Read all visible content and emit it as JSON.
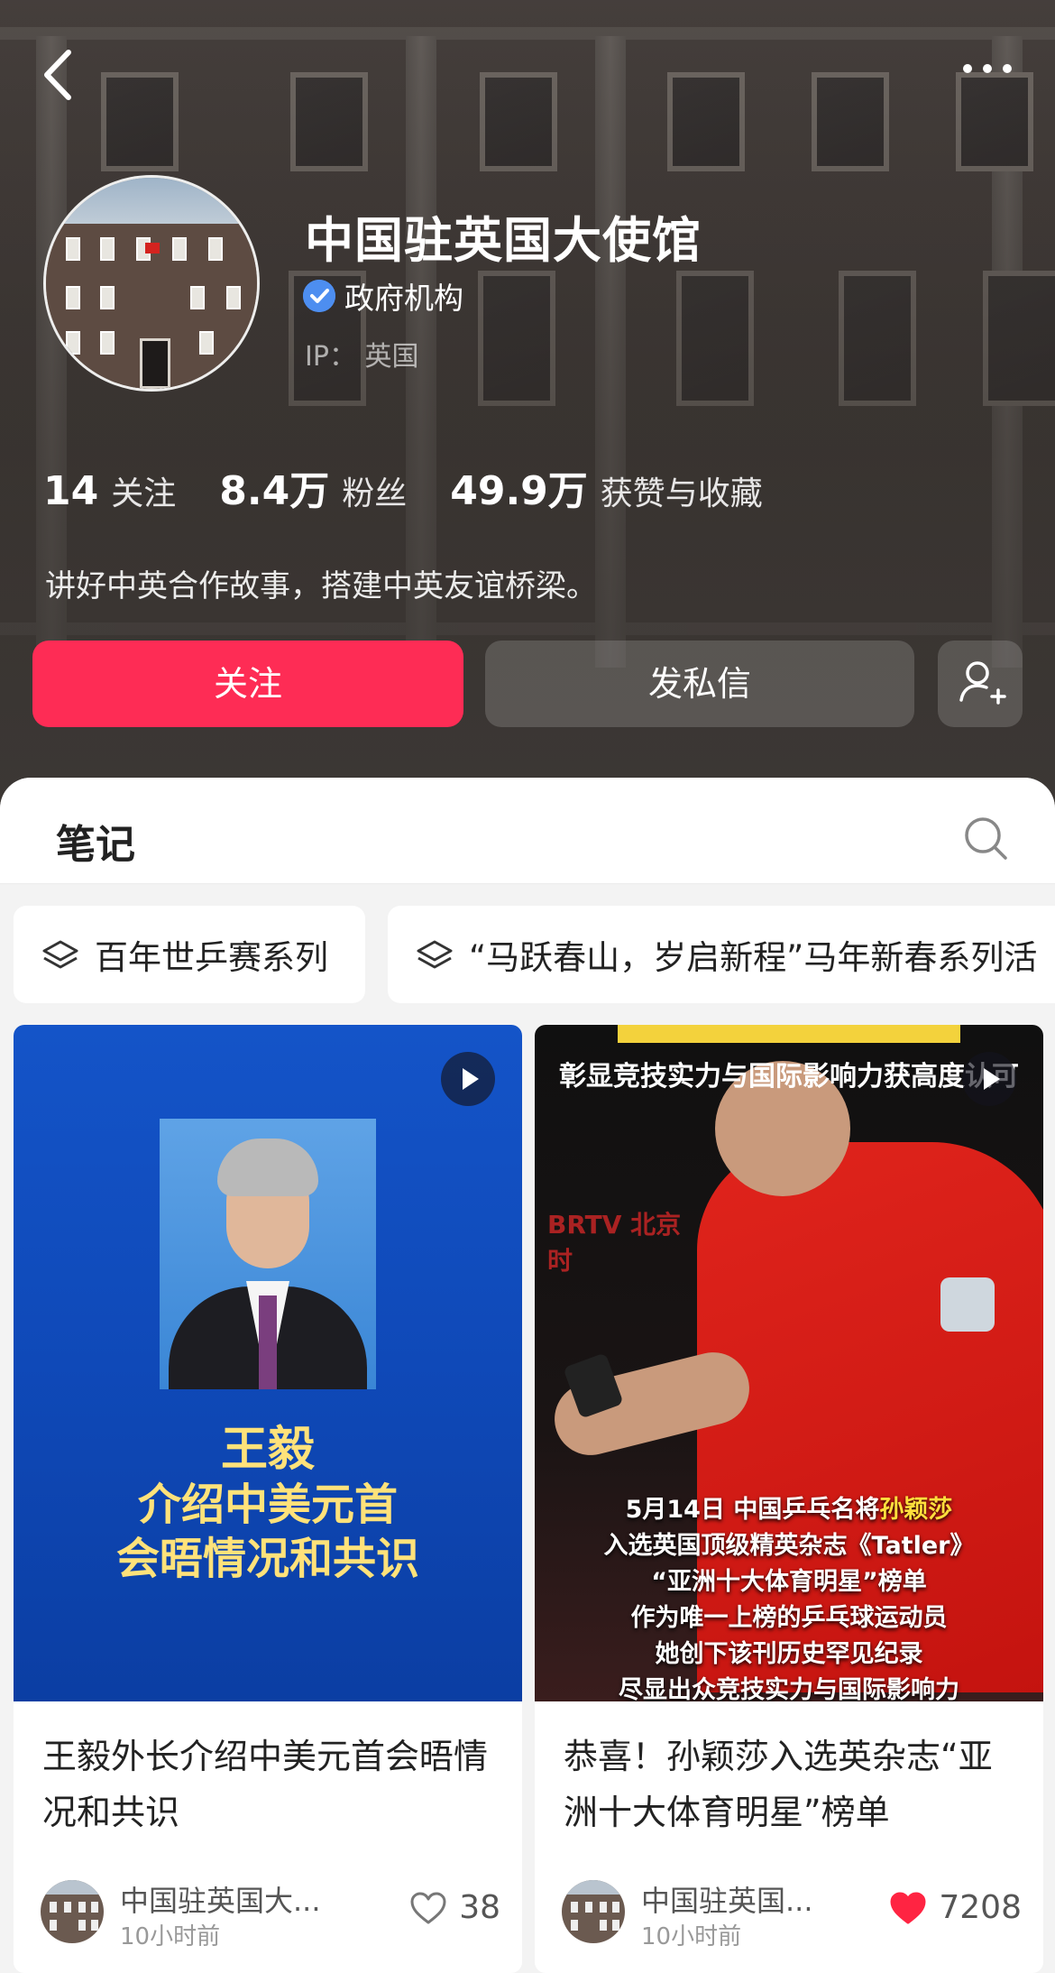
{
  "header": {
    "account_name": "中国驻英国大使馆",
    "verified_label": "政府机构",
    "ip_label": "IP：",
    "ip_value": "英国",
    "icons": {
      "back": "back-chevron-icon",
      "more": "more-dots-icon",
      "verified": "verified-check-icon",
      "add_user": "add-user-icon"
    }
  },
  "stats": [
    {
      "value": "14",
      "label": "关注"
    },
    {
      "value": "8.4万",
      "label": "粉丝"
    },
    {
      "value": "49.9万",
      "label": "获赞与收藏"
    }
  ],
  "bio": "讲好中英合作故事，搭建中英友谊桥梁。",
  "actions": {
    "follow": "关注",
    "message": "发私信"
  },
  "tabs": {
    "notes": "笔记"
  },
  "collections": [
    {
      "label": "百年世乒赛系列"
    },
    {
      "label": "“马跃春山，岁启新程”马年新春系列活"
    }
  ],
  "notes": [
    {
      "thumbnail_text": [
        "王毅",
        "介绍中美元首",
        "会晤情况和共识"
      ],
      "title": "王毅外长介绍中美元首会晤情况和共识",
      "author": "中国驻英国大...",
      "time": "10小时前",
      "likes": "38",
      "liked": false
    },
    {
      "thumbnail_top": [
        "作为唯一上榜乒乓球运动员",
        "彰显竞技实力与国际影响力获高度认可"
      ],
      "thumbnail_logo": "BRTV 北京时",
      "thumbnail_text": [
        "5月14日 中国乒乓名将孙颖莎",
        "入选英国顶级精英杂志《Tatler》",
        "“亚洲十大体育明星”榜单",
        "作为唯一上榜的乒乓球运动员",
        "她创下该刊历史罕见纪录",
        "尽显出众竞技实力与国际影响力"
      ],
      "title": "恭喜！孙颖莎入选英杂志“亚洲十大体育明星”榜单",
      "author": "中国驻英国...",
      "time": "10小时前",
      "likes": "7208",
      "liked": true
    }
  ],
  "colors": {
    "accent": "#fe2c55",
    "verified": "#4d8ef0",
    "liked": "#ff2442"
  }
}
